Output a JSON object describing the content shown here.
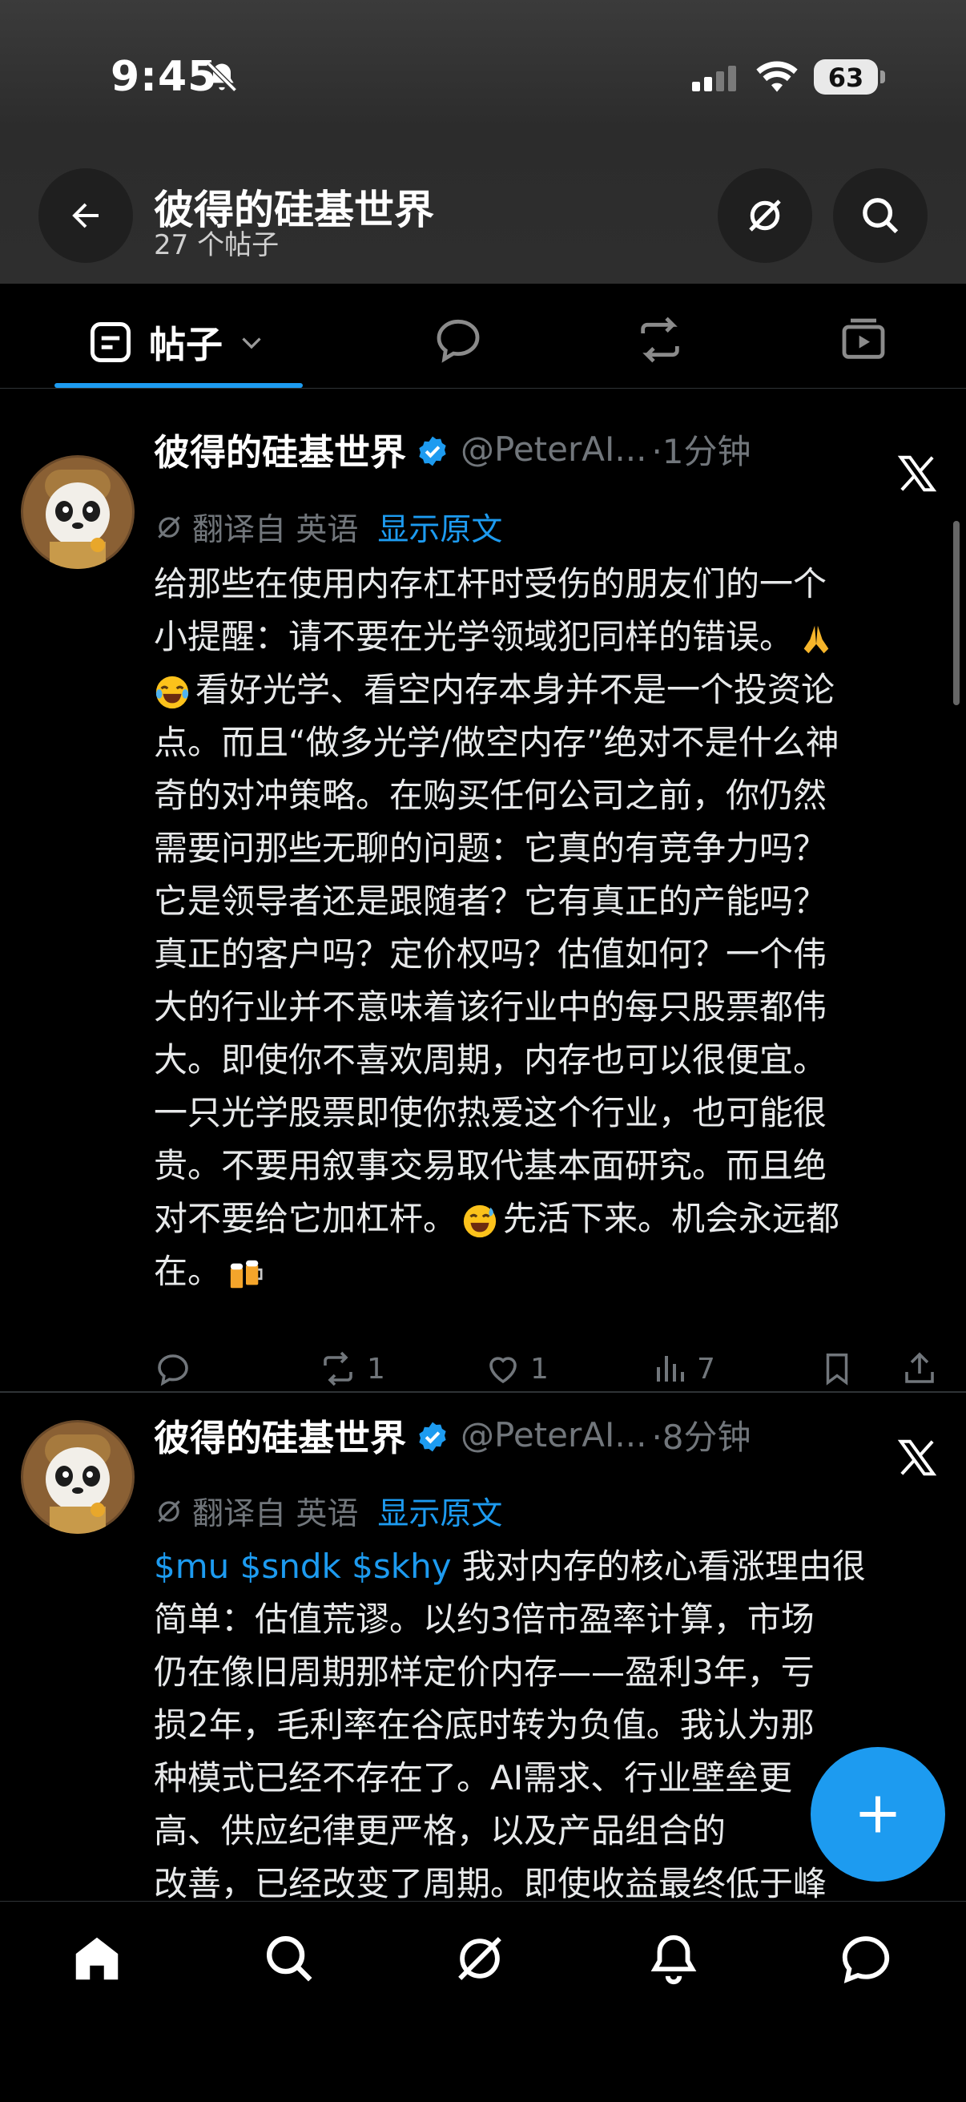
{
  "status_bar": {
    "time": "9:45",
    "battery": "63"
  },
  "header": {
    "title": "彼得的硅基世界",
    "subtitle": "27 个帖子"
  },
  "tabs": {
    "posts_label": "帖子"
  },
  "posts": [
    {
      "author": "彼得的硅基世界",
      "handle": "@PeterAI...",
      "time": "·1分钟",
      "translated_label": "翻译自 英语",
      "show_original": "显示原文",
      "lines": [
        "给那些在使用内存杠杆时受伤的朋友们的一个",
        "小提醒：请不要在光学领域犯同样的错误。",
        "看好光学、看空内存本身并不是一个投资论",
        "点。而且“做多光学/做空内存”绝对不是什么神",
        "奇的对冲策略。在购买任何公司之前，你仍然",
        "需要问那些无聊的问题：它真的有竞争力吗？",
        "它是领导者还是跟随者？它有真正的产能吗？",
        "真正的客户吗？定价权吗？估值如何？一个伟",
        "大的行业并不意味着该行业中的每只股票都伟",
        "大。即使你不喜欢周期，内存也可以很便宜。",
        "一只光学股票即使你热爱这个行业，也可能很",
        "贵。不要用叙事交易取代基本面研究。而且绝",
        "对不要给它加杠杆。",
        "先活下来。机会永远都",
        "在。"
      ],
      "retweets": "1",
      "likes": "1",
      "views": "7"
    },
    {
      "author": "彼得的硅基世界",
      "handle": "@PeterAI...",
      "time": "·8分钟",
      "translated_label": "翻译自 英语",
      "show_original": "显示原文",
      "cashtags": "$mu $sndk $skhy",
      "lines": [
        "我对内存的核心看涨理由很",
        "简单：估值荒谬。以约3倍市盈率计算，市场",
        "仍在像旧周期那样定价内存——盈利3年，亏",
        "损2年，毛利率在谷底时转为负值。我认为那",
        "种模式已经不存在了。AI需求、行业壁垒更",
        "高、供应纪律更严格，以及产品组合的",
        "改善，已经改变了周期。即使收益最终低于峰"
      ]
    }
  ],
  "icons": {
    "back": "arrow-left-icon",
    "grok": "grok-icon",
    "search": "search-icon",
    "verified": "verified-badge-icon",
    "x_logo": "x-logo-icon",
    "compose": "plus-icon"
  },
  "colors": {
    "accent": "#1d9bf0",
    "muted": "#71767b",
    "text": "#e7e9ea",
    "background": "#000000"
  }
}
